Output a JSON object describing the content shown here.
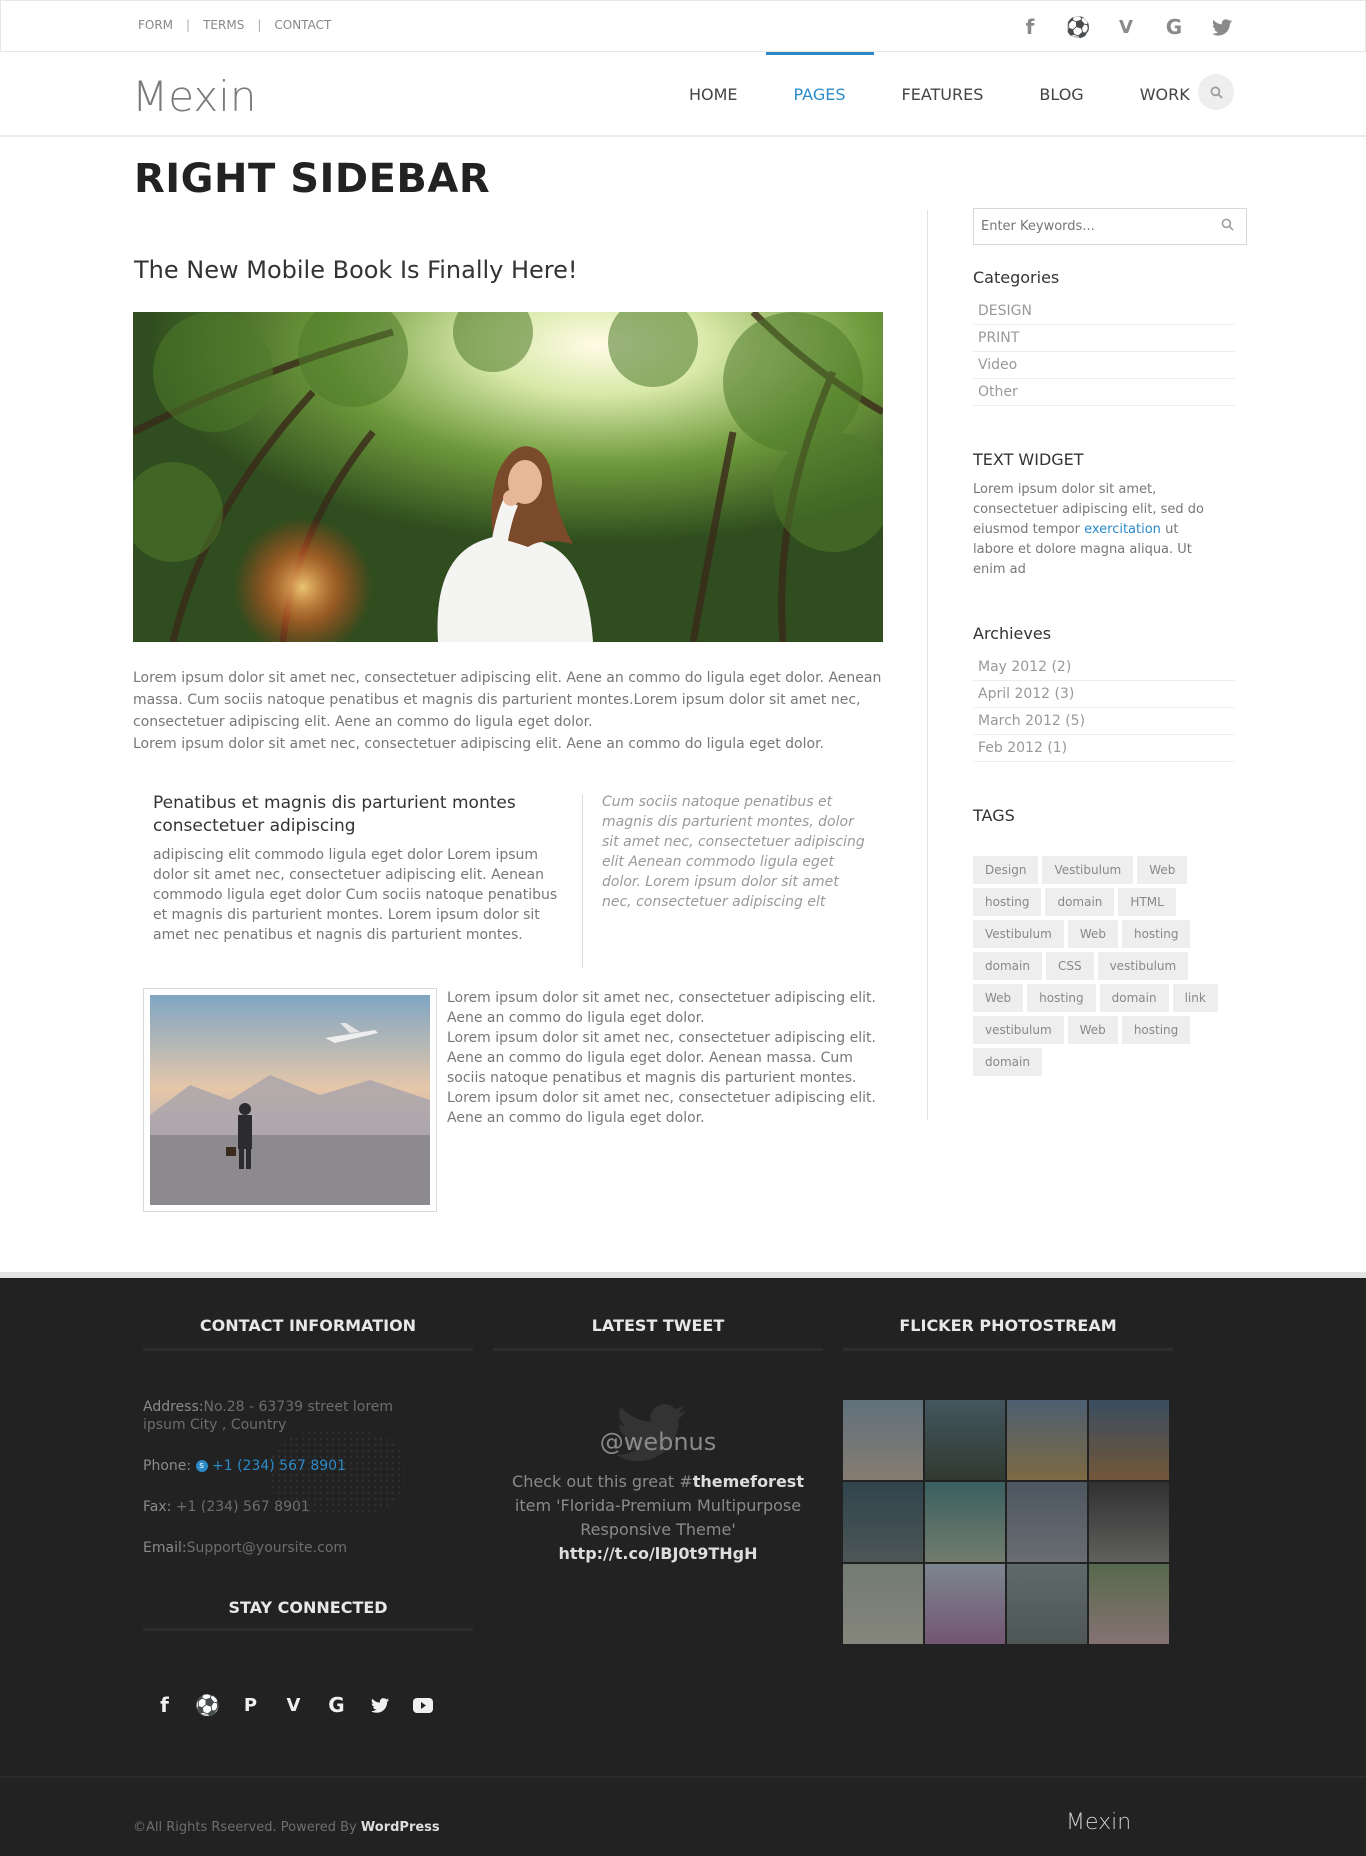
{
  "topbar": {
    "links": [
      "FORM",
      "TERMS",
      "CONTACT"
    ],
    "social": [
      "facebook-icon",
      "dribbble-icon",
      "vimeo-icon",
      "google-icon",
      "twitter-icon"
    ]
  },
  "header": {
    "logo": "Mexin",
    "nav": [
      "HOME",
      "PAGES",
      "FEATURES",
      "BLOG",
      "WORK"
    ],
    "active_nav": "PAGES",
    "accent": "#2b8ac8"
  },
  "main": {
    "page_title": "RIGHT SIDEBAR",
    "post_title": "The New Mobile Book Is Finally Here!",
    "intro": "Lorem ipsum dolor sit amet nec, consectetuer adipiscing elit. Aene an commo do ligula eget dolor. Aenean massa. Cum sociis natoque penatibus et magnis dis parturient montes.Lorem ipsum dolor sit amet nec, consectetuer adipiscing elit. Aene an commo do ligula eget dolor.",
    "intro2": "Lorem ipsum dolor sit amet nec, consectetuer adipiscing elit. Aene an commo do ligula eget dolor.",
    "col_left_title": "Penatibus et magnis dis parturient montes consectetuer adipiscing",
    "col_left_text": "adipiscing elit commodo ligula eget dolor Lorem ipsum dolor sit amet nec, consectetuer adipiscing elit. Aenean commodo ligula eget dolor Cum sociis natoque penatibus et magnis dis parturient montes. Lorem ipsum dolor sit amet nec penatibus et nagnis dis parturient montes.",
    "col_right_quote": "Cum sociis natoque penatibus et magnis dis parturient montes, dolor sit amet nec, consectetuer adipiscing elit Aenean commodo ligula eget dolor. Lorem ipsum dolor sit amet nec, consectetuer adipiscing elt",
    "thumb_text_1": "Lorem ipsum dolor sit amet nec, consectetuer adipiscing elit. Aene an commo do ligula eget dolor.",
    "thumb_text_2": "Lorem ipsum dolor sit amet nec, consectetuer adipiscing elit. Aene an commo do ligula eget dolor. Aenean massa. Cum sociis natoque penatibus et magnis dis parturient montes. Lorem ipsum dolor sit amet nec, consectetuer adipiscing elit. Aene an commo do ligula eget dolor."
  },
  "sidebar": {
    "search_placeholder": "Enter Keywords...",
    "categories_title": "Categories",
    "categories": [
      "DESIGN",
      "PRINT",
      "Video",
      "Other"
    ],
    "text_widget_title": "TEXT WIDGET",
    "text_widget_a": "Lorem ipsum dolor sit amet, consectetuer adipiscing elit, sed do eiusmod tempor",
    "text_widget_link": "exercitation",
    "text_widget_b": "ut labore et dolore magna aliqua. Ut enim ad",
    "archives_title": "Archieves",
    "archives": [
      "May 2012 (2)",
      "April 2012 (3)",
      "March 2012 (5)",
      "Feb 2012 (1)"
    ],
    "tags_title": "TAGS",
    "tags": [
      "Design",
      "Vestibulum",
      "Web",
      "hosting",
      "domain",
      "HTML",
      "Vestibulum",
      "Web",
      "hosting",
      "domain",
      "CSS",
      "vestibulum",
      "Web",
      "hosting",
      "domain",
      "link",
      "vestibulum",
      "Web",
      "hosting",
      "domain"
    ]
  },
  "footer": {
    "contact_title": "CONTACT INFORMATION",
    "address_label": "Address:",
    "address": "No.28 - 63739 street lorem ipsum City , Country",
    "phone_label": "Phone:",
    "phone": "+1 (234) 567 8901",
    "fax_label": "Fax:",
    "fax": "+1 (234) 567 8901",
    "email_label": "Email:",
    "email": "Support@yoursite.com",
    "stay_title": "STAY CONNECTED",
    "social": [
      "facebook-icon",
      "dribbble-icon",
      "pinterest-icon",
      "vimeo-icon",
      "google-icon",
      "twitter-icon",
      "youtube-icon"
    ],
    "tweet_title": "LATEST TWEET",
    "tweet_handle": "@webnus",
    "tweet_a": "Check out this great #",
    "tweet_bold": "themeforest",
    "tweet_b": " item 'Florida-Premium Multipurpose Responsive Theme'",
    "tweet_link": "http://t.co/lBJ0t9THgH",
    "flickr_title": "FLICKER PHOTOSTREAM",
    "copyright_a": "©All Rights Rseerved. Powered By ",
    "copyright_b": "WordPress",
    "copy_logo": "Mexin"
  }
}
